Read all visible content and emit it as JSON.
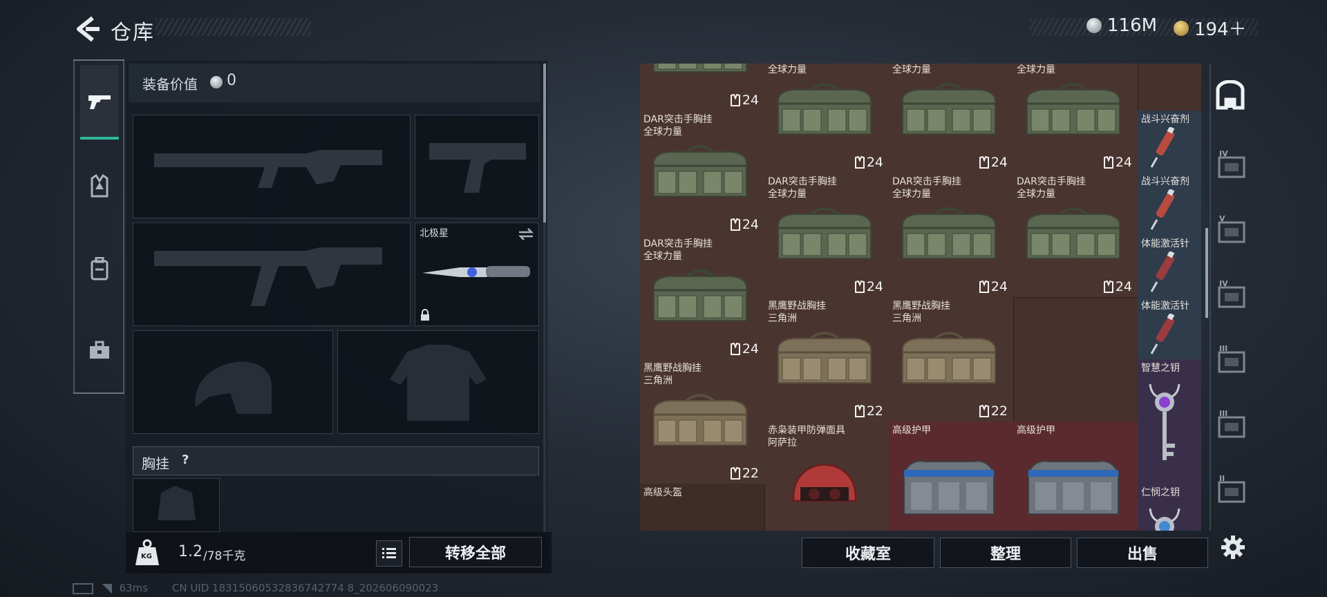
{
  "header": {
    "title": "仓库",
    "currencies": [
      {
        "name": "silver-coin",
        "value": "116M",
        "color": "#b8bec6"
      },
      {
        "name": "gold-coin",
        "value": "194＋",
        "color": "#c8a24a"
      }
    ]
  },
  "left_tabs": [
    {
      "icon": "pistol-icon",
      "selected": true
    },
    {
      "icon": "armor-vest-icon",
      "selected": false
    },
    {
      "icon": "backpack-icon",
      "selected": false
    },
    {
      "icon": "toolbox-icon",
      "selected": false
    }
  ],
  "equipment": {
    "value_label": "装备价值",
    "value": "0",
    "melee_name": "北极星",
    "chest_rig_label": "胸挂",
    "chest_rig_help": "?",
    "weight_current": "1.2",
    "weight_capacity": "/78千克",
    "weight_icon_text": "KG",
    "transfer_all": "转移全部"
  },
  "warehouse": {
    "actions": {
      "collection": "收藏室",
      "organize": "整理",
      "sell": "出售"
    },
    "col_side": [
      {
        "title": "战斗兴奋剂",
        "type": "syringe",
        "color": "#b84b3f"
      },
      {
        "title": "战斗兴奋剂",
        "type": "syringe",
        "color": "#b84b3f"
      },
      {
        "title": "体能激活针",
        "type": "syringe",
        "color": "#9b3b3f"
      },
      {
        "title": "体能激活针",
        "type": "syringe",
        "color": "#9b3b3f"
      },
      {
        "title": "智慧之钥",
        "type": "key",
        "gem": "#8a3fd0"
      },
      {
        "title": "仁悯之钥",
        "type": "key",
        "gem": "#3f8ad0"
      }
    ],
    "items": [
      {
        "title": "",
        "qty": "24",
        "type": "bag-green"
      },
      {
        "title": "DAR突击手胸挂\n全球力量",
        "qty": "24",
        "type": "bag-green"
      },
      {
        "title": "DAR突击手胸挂\n全球力量",
        "qty": "24",
        "type": "bag-green"
      },
      {
        "title": "DAR突击手胸挂\n全球力量",
        "qty": "24",
        "type": "bag-green"
      },
      {
        "title": "DAR突击手胸挂\n全球力量",
        "qty": "24",
        "type": "bag-green"
      },
      {
        "title": "DAR突击手胸挂\n全球力量",
        "qty": "24",
        "type": "bag-green"
      },
      {
        "title": "DAR突击手胸挂\n全球力量",
        "qty": "24",
        "type": "bag-green"
      },
      {
        "title": "DAR突击手胸挂\n全球力量",
        "qty": "24",
        "type": "bag-green"
      },
      {
        "title": "DAR突击手胸挂\n全球力量",
        "qty": "24",
        "type": "bag-green"
      },
      {
        "title": "黑鹰野战胸挂\n三角洲",
        "qty": "22",
        "type": "bag-tan"
      },
      {
        "title": "黑鹰野战胸挂\n三角洲",
        "qty": "22",
        "type": "bag-tan"
      },
      {
        "title": "黑鹰野战胸挂\n三角洲",
        "qty": "22",
        "type": "bag-tan"
      },
      {
        "title": "赤枭装甲防弹面具\n阿萨拉",
        "qty": "",
        "type": "helmet"
      },
      {
        "title": "高级护甲",
        "qty": "",
        "type": "armor"
      },
      {
        "title": "高级护甲",
        "qty": "",
        "type": "armor"
      },
      {
        "title": "高级头盔",
        "qty": "",
        "type": "empty"
      }
    ],
    "top_qty": [
      "24",
      "24",
      "24"
    ]
  },
  "right_tabs": [
    "IV",
    "V",
    "IV",
    "III",
    "III",
    "II"
  ],
  "footer": {
    "ping": "63ms",
    "uid": "CN UID 18315060532836742774 8_202606090023"
  }
}
